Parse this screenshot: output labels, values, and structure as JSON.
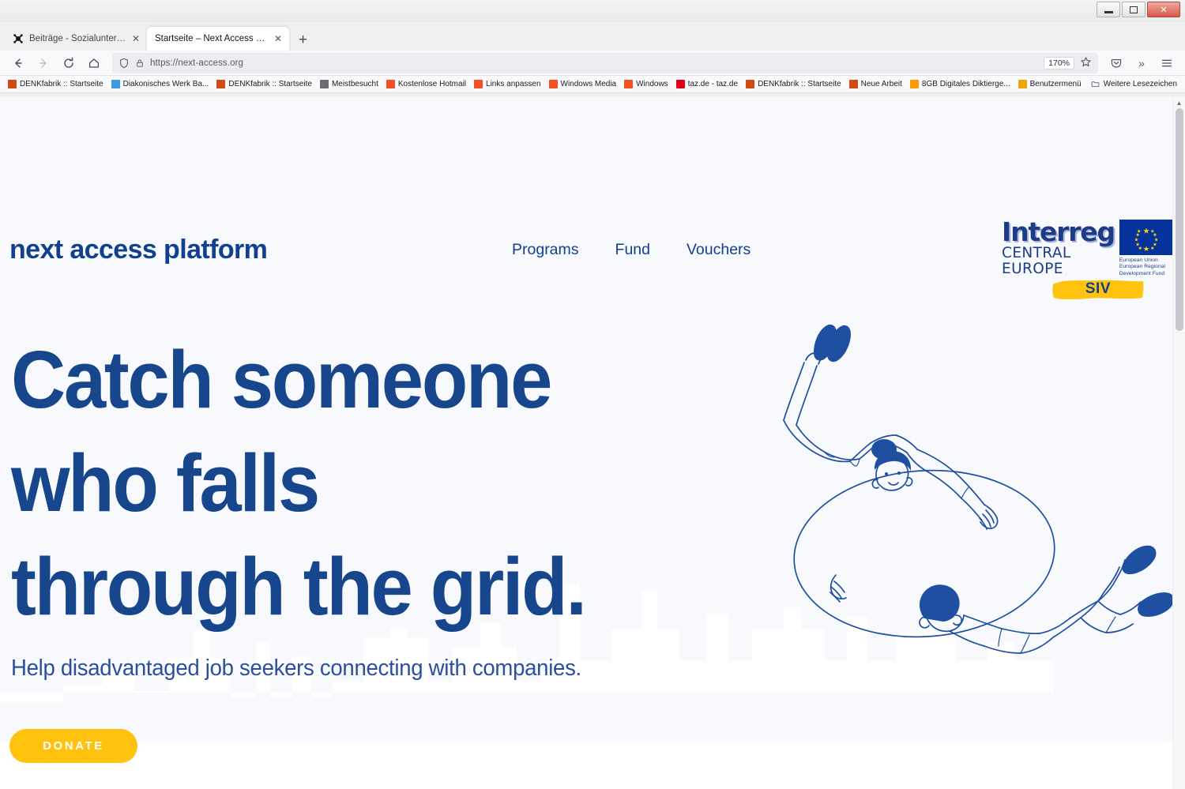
{
  "window": {
    "minimize_label": "Minimize",
    "maximize_label": "Restore",
    "close_label": "Close"
  },
  "browser": {
    "tabs": [
      {
        "title": "Beiträge - Sozialunternehmen N",
        "favicon": "joomla-icon",
        "active": false,
        "close_label": "✕"
      },
      {
        "title": "Startseite – Next Access Platform",
        "favicon": "page-icon",
        "active": true,
        "close_label": "✕"
      }
    ],
    "new_tab_label": "+",
    "toolbar": {
      "back_label": "←",
      "forward_label": "→",
      "reload_label": "⟳",
      "home_label": "⌂",
      "shield_label": "shield",
      "lock_label": "lock",
      "url": "https://next-access.org",
      "zoom_level": "170%",
      "bookmark_star_label": "☆",
      "pocket_label": "pocket",
      "overflow_label": "»",
      "menu_label": "☰"
    },
    "bookmarks": [
      {
        "label": "DENKfabrik :: Startseite",
        "icon_color": "#d14a10"
      },
      {
        "label": "Diakonisches Werk Ba...",
        "icon_color": "#3d9ae2"
      },
      {
        "label": "DENKfabrik :: Startseite",
        "icon_color": "#d14a10"
      },
      {
        "label": "Meistbesucht",
        "icon_color": "#6b6b72"
      },
      {
        "label": "Kostenlose Hotmail",
        "icon_color": "#f25022"
      },
      {
        "label": "Links anpassen",
        "icon_color": "#f25022"
      },
      {
        "label": "Windows Media",
        "icon_color": "#f25022"
      },
      {
        "label": "Windows",
        "icon_color": "#f25022"
      },
      {
        "label": "taz.de - taz.de",
        "icon_color": "#e2001a"
      },
      {
        "label": "DENKfabrik :: Startseite",
        "icon_color": "#d14a10"
      },
      {
        "label": "Neue Arbeit",
        "icon_color": "#d14a10"
      },
      {
        "label": "8GB Digitales Diktierge...",
        "icon_color": "#ff9900"
      },
      {
        "label": "Benutzermenü",
        "icon_color": "#f0a30a"
      }
    ],
    "bookmarks_overflow": "Weitere Lesezeichen"
  },
  "site": {
    "brand": "next access platform",
    "nav": [
      {
        "label": "Programs"
      },
      {
        "label": "Fund"
      },
      {
        "label": "Vouchers"
      }
    ],
    "logo": {
      "word": "Interreg",
      "subtitle": "CENTRAL EUROPE",
      "eu_caption_line1": "European Union",
      "eu_caption_line2": "European Regional",
      "eu_caption_line3": "Development Fund",
      "badge": "SIV"
    },
    "hero": {
      "title_line1": "Catch someone",
      "title_line2": "who falls",
      "title_line3": "through the grid.",
      "subtitle": "Help disadvantaged job seekers connecting with companies.",
      "cta": "DONATE"
    },
    "colors": {
      "brand_blue": "#12408f",
      "headline_blue": "#17468d",
      "accent_yellow": "#ffc20e",
      "page_background": "#f7f9fc"
    }
  }
}
